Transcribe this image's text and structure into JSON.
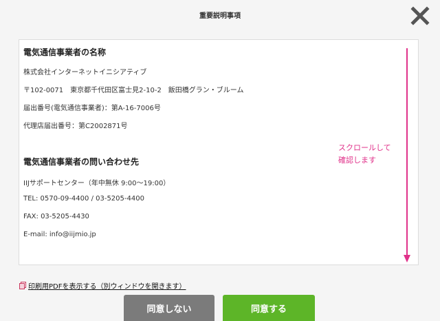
{
  "modal": {
    "title": "重要説明事項"
  },
  "content": {
    "section1": {
      "heading": "電気通信事業者の名称",
      "lines": [
        "株式会社インターネットイニシアティブ",
        "〒102-0071　東京都千代田区富士見2-10-2　飯田橋グラン・ブルーム",
        "届出番号(電気通信事業者)：第A-16-7006号",
        "代理店届出番号：第C2002871号"
      ]
    },
    "section2": {
      "heading": "電気通信事業者の問い合わせ先",
      "lines": [
        "IIJサポートセンター（年中無休 9:00～19:00）",
        "TEL: 0570-09-4400 / 03-5205-4400",
        "FAX: 03-5205-4430",
        "E-mail: info@iijmio.jp"
      ]
    },
    "scroll_hint": [
      "スクロールして",
      "確認します"
    ]
  },
  "pdf_link": {
    "label": "印刷用PDFを表示する（別ウィンドウを開きます）"
  },
  "buttons": {
    "disagree": "同意しない",
    "agree": "同意する"
  },
  "colors": {
    "accent_pink": "#e0318a",
    "agree_green": "#5db528",
    "disagree_gray": "#7b7b7b"
  },
  "icons": {
    "close": "close-icon",
    "pdf": "document-icon",
    "arrow": "arrow-down-icon"
  }
}
